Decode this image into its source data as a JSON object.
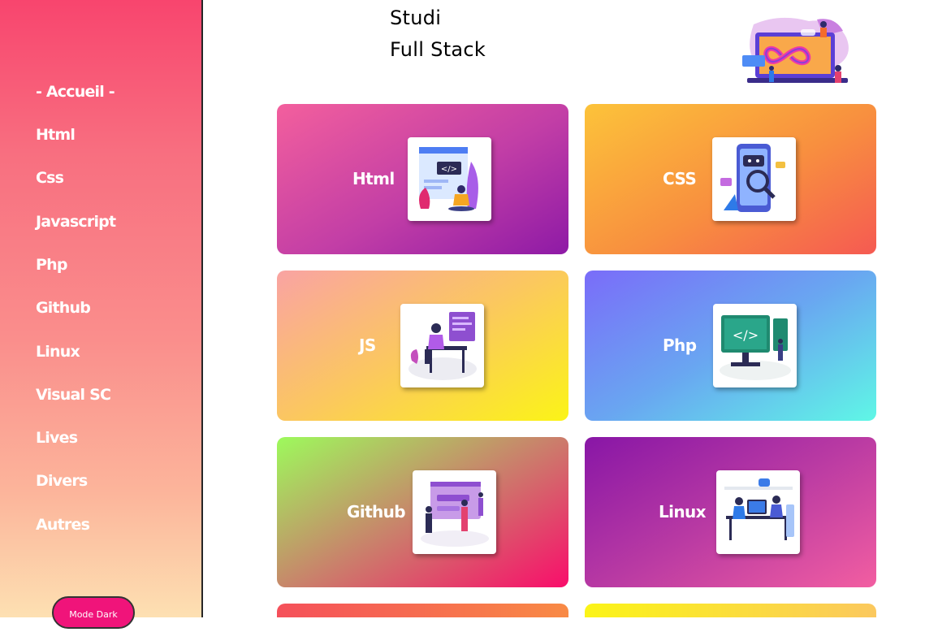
{
  "sidebar": {
    "items": [
      {
        "label": "- Accueil -"
      },
      {
        "label": "Html"
      },
      {
        "label": "Css"
      },
      {
        "label": "Javascript"
      },
      {
        "label": "Php"
      },
      {
        "label": "Github"
      },
      {
        "label": "Linux"
      },
      {
        "label": "Visual SC"
      },
      {
        "label": "Lives"
      },
      {
        "label": "Divers"
      },
      {
        "label": "Autres"
      }
    ],
    "mode_button": "Mode Dark"
  },
  "header": {
    "line1": "Studi",
    "line2": "Full Stack"
  },
  "cards": [
    {
      "label": "Html",
      "colors": [
        "#f35f9d",
        "#8e1aa6"
      ],
      "icon": "html-illustration-icon"
    },
    {
      "label": "CSS",
      "colors": [
        "#fcc33a",
        "#f55a52"
      ],
      "icon": "css-illustration-icon"
    },
    {
      "label": "JS",
      "colors": [
        "#f9a3a3",
        "#fbf417"
      ],
      "icon": "js-illustration-icon"
    },
    {
      "label": "Php",
      "colors": [
        "#7a6cf9",
        "#5ff7e6"
      ],
      "icon": "php-illustration-icon"
    },
    {
      "label": "Github",
      "colors": [
        "#9dfa5c",
        "#f90d6b"
      ],
      "icon": "github-illustration-icon"
    },
    {
      "label": "Linux",
      "colors": [
        "#8816a6",
        "#f25ea1"
      ],
      "icon": "linux-illustration-icon"
    }
  ]
}
